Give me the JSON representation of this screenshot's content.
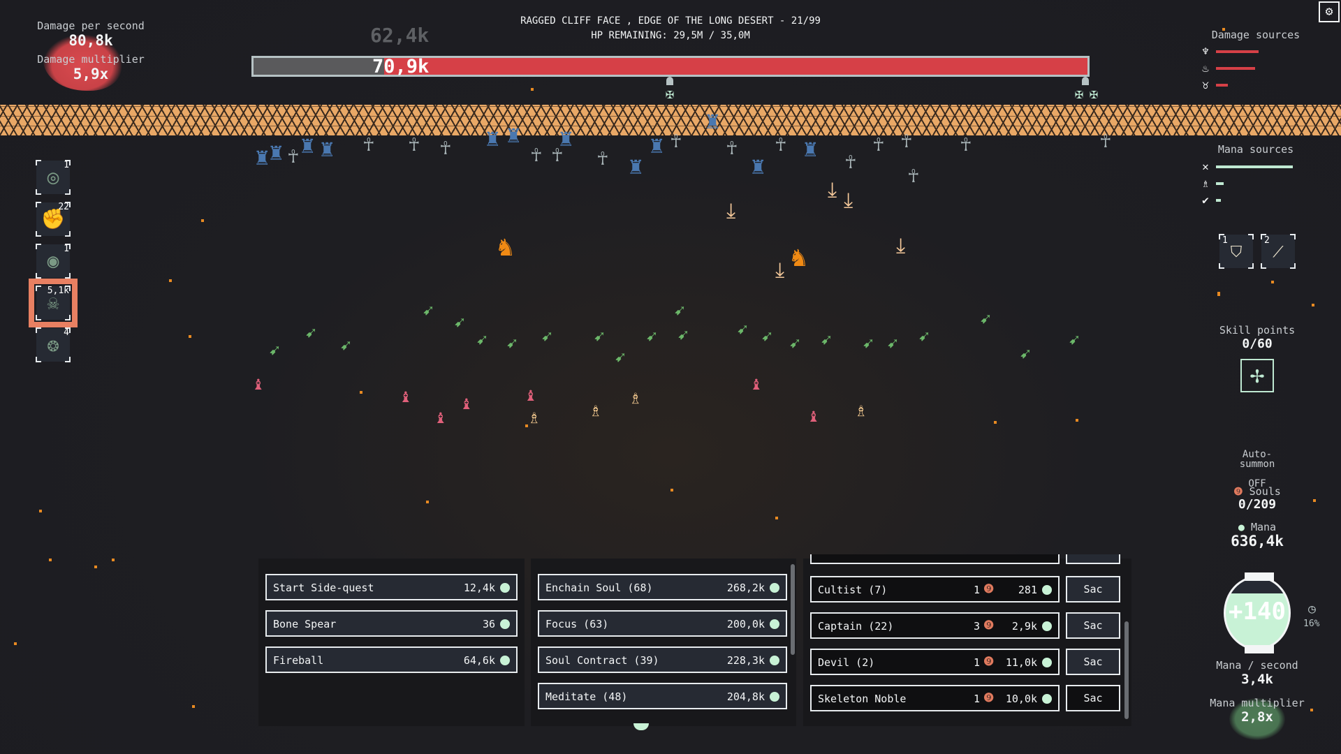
{
  "stats": {
    "dps_label": "Damage per second",
    "dps_value": "80,8k",
    "multiplier_label": "Damage multiplier",
    "multiplier_value": "5,9x"
  },
  "boss": {
    "title": "RAGGED CLIFF FACE , EDGE OF THE LONG DESERT - 21/99",
    "hp_text": "HP REMAINING: 29,5M / 35,0M",
    "hp_remaining_fraction": 0.843,
    "damage_popup": "70,9k",
    "damage_ghost": "62,4k",
    "colors": {
      "hp": "#d64047",
      "lost": "#5a5a5c"
    }
  },
  "skills": [
    {
      "icon": "vortex-icon",
      "glyph": "◎",
      "count": "1",
      "active": false
    },
    {
      "icon": "fist-icon",
      "glyph": "✊",
      "count": "22",
      "active": false
    },
    {
      "icon": "target-icon",
      "glyph": "◉",
      "count": "1",
      "active": false
    },
    {
      "icon": "poison-skull-icon",
      "glyph": "☠",
      "count": "5,1k",
      "active": true
    },
    {
      "icon": "brain-icon",
      "glyph": "❂",
      "count": "4",
      "active": false
    }
  ],
  "damage_sources": {
    "title": "Damage sources",
    "items": [
      {
        "icon": "skeleton-warrior-icon",
        "glyph": "♆",
        "share": 0.55
      },
      {
        "icon": "soul-drop-icon",
        "glyph": "♨",
        "share": 0.51
      },
      {
        "icon": "demon-head-icon",
        "glyph": "♉",
        "share": 0.15
      }
    ],
    "color": "#d64047"
  },
  "mana_sources": {
    "title": "Mana sources",
    "items": [
      {
        "icon": "sparkle-icon",
        "glyph": "✕",
        "share": 1.0
      },
      {
        "icon": "priest-icon",
        "glyph": "♗",
        "share": 0.1
      },
      {
        "icon": "shield-check-icon",
        "glyph": "✔",
        "share": 0.06
      }
    ],
    "color": "#bfe9d2"
  },
  "spell_slots": [
    {
      "num": "1",
      "icon": "shield-icon",
      "glyph": "⛉"
    },
    {
      "num": "2",
      "icon": "spear-icon",
      "glyph": "⟋"
    }
  ],
  "skill_points": {
    "label": "Skill points",
    "value": "0/60"
  },
  "auto_summon": {
    "label": "Auto-\nsummon",
    "state": "OFF"
  },
  "souls": {
    "label": "Souls",
    "value": "0/209"
  },
  "mana": {
    "label": "Mana",
    "value": "636,4k",
    "orb_text": "+140",
    "orb_fill_fraction": 0.78,
    "timer_pct": "16%",
    "per_second_label": "Mana / second",
    "per_second_value": "3,4k",
    "multiplier_label": "Mana multiplier",
    "multiplier_value": "2,8x"
  },
  "actions_panel": [
    {
      "label": "Start Side-quest",
      "cost": "12,4k"
    },
    {
      "label": "Bone Spear",
      "cost": "36"
    },
    {
      "label": "Fireball",
      "cost": "64,6k"
    }
  ],
  "upgrades_panel": [
    {
      "label": "Enchain Soul (68)",
      "cost": "268,2k"
    },
    {
      "label": "Focus (63)",
      "cost": "200,0k"
    },
    {
      "label": "Soul Contract (39)",
      "cost": "228,3k"
    },
    {
      "label": "Meditate (48)",
      "cost": "204,8k"
    }
  ],
  "minions_panel": {
    "sac_label": "Sac",
    "rows": [
      {
        "label": "Cultist (7)",
        "souls": "1",
        "cost": "281",
        "sac_highlight": true
      },
      {
        "label": "Captain (22)",
        "souls": "3",
        "cost": "2,9k",
        "sac_highlight": true
      },
      {
        "label": "Devil (2)",
        "souls": "1",
        "cost": "11,0k",
        "sac_highlight": true
      },
      {
        "label": "Skeleton Noble",
        "souls": "1",
        "cost": "10,0k",
        "sac_highlight": false
      }
    ]
  },
  "settings": {
    "icon": "settings-icon",
    "glyph": "⚙"
  }
}
